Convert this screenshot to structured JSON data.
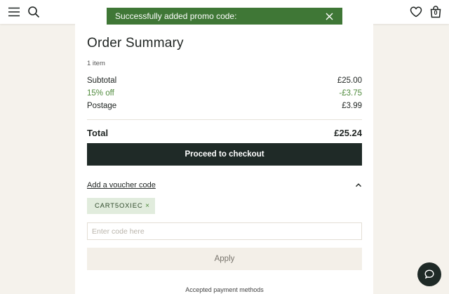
{
  "toast": {
    "message": "Successfully added promo code:"
  },
  "header": {
    "basket_count": "0"
  },
  "order_summary": {
    "title": "Order Summary",
    "items_count": "1 item",
    "subtotal_label": "Subtotal",
    "subtotal_value": "£25.00",
    "discount_label": "15% off",
    "discount_value": "-£3.75",
    "postage_label": "Postage",
    "postage_value": "£3.99",
    "total_label": "Total",
    "total_value": "£25.24",
    "checkout_label": "Proceed to checkout"
  },
  "voucher": {
    "toggle_label": "Add a voucher code",
    "applied_code": "CART5OXIEC",
    "remove_symbol": "×",
    "input_placeholder": "Enter code here",
    "apply_label": "Apply"
  },
  "footer": {
    "payments_label": "Accepted payment methods"
  },
  "colors": {
    "success_green": "#3f7736",
    "primary_dark": "#1f2a27",
    "background": "#f5f2ec"
  }
}
